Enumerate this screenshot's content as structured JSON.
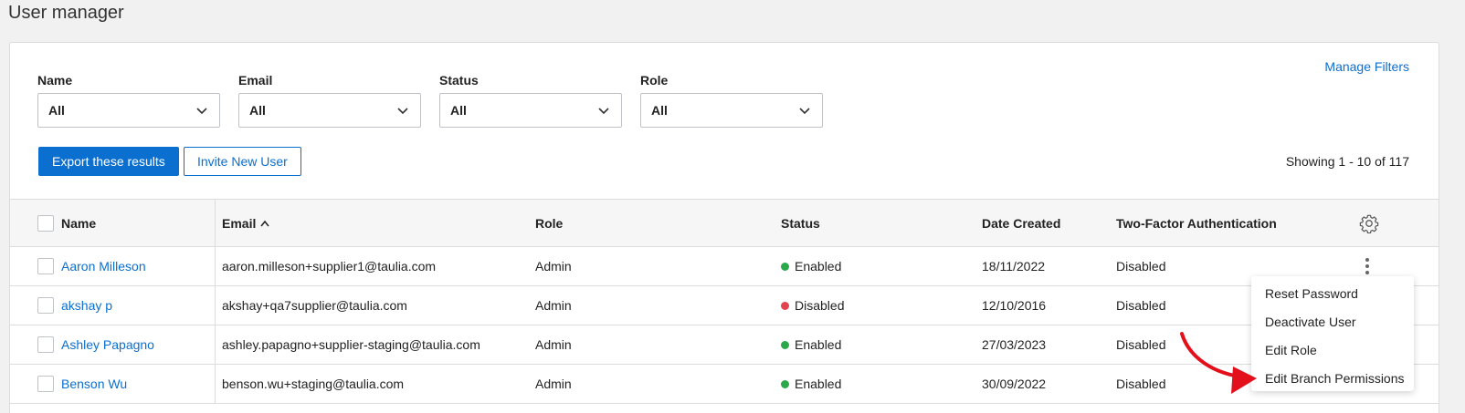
{
  "page": {
    "title": "User manager"
  },
  "filters": {
    "manage_filters_label": "Manage Filters",
    "items": [
      {
        "label": "Name",
        "value": "All"
      },
      {
        "label": "Email",
        "value": "All"
      },
      {
        "label": "Status",
        "value": "All"
      },
      {
        "label": "Role",
        "value": "All"
      }
    ]
  },
  "actions": {
    "export_label": "Export these results",
    "invite_label": "Invite New User",
    "showing_text": "Showing 1 - 10 of 117"
  },
  "table": {
    "columns": {
      "name": "Name",
      "email": "Email",
      "role": "Role",
      "status": "Status",
      "date_created": "Date Created",
      "two_factor": "Two-Factor Authentication"
    },
    "sort_icon": "sort-ascending-icon",
    "rows": [
      {
        "name": "Aaron Milleson",
        "email": "aaron.milleson+supplier1@taulia.com",
        "role": "Admin",
        "status": "Enabled",
        "status_color": "#2aa84a",
        "date": "18/11/2022",
        "two_factor": "Disabled"
      },
      {
        "name": "akshay p",
        "email": "akshay+qa7supplier@taulia.com",
        "role": "Admin",
        "status": "Disabled",
        "status_color": "#e0454f",
        "date": "12/10/2016",
        "two_factor": "Disabled"
      },
      {
        "name": "Ashley Papagno",
        "email": "ashley.papagno+supplier-staging@taulia.com",
        "role": "Admin",
        "status": "Enabled",
        "status_color": "#2aa84a",
        "date": "27/03/2023",
        "two_factor": "Disabled"
      },
      {
        "name": "Benson Wu",
        "email": "benson.wu+staging@taulia.com",
        "role": "Admin",
        "status": "Enabled",
        "status_color": "#2aa84a",
        "date": "30/09/2022",
        "two_factor": "Disabled"
      }
    ]
  },
  "context_menu": {
    "items": [
      {
        "label": "Reset Password"
      },
      {
        "label": "Deactivate User"
      },
      {
        "label": "Edit Role"
      },
      {
        "label": "Edit Branch Permissions"
      }
    ]
  },
  "colors": {
    "accent": "#0b6fcf",
    "annotation_arrow": "#e3101c"
  }
}
